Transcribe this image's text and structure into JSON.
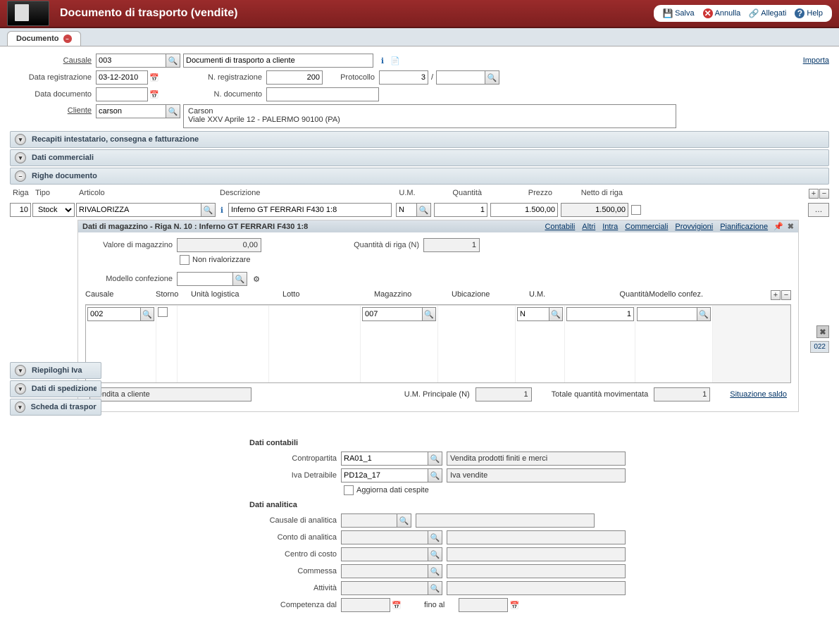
{
  "header": {
    "title": "Documento di trasporto (vendite)",
    "toolbar": {
      "save": "Salva",
      "cancel": "Annulla",
      "attach": "Allegati",
      "help": "Help"
    }
  },
  "tab": {
    "label": "Documento"
  },
  "form": {
    "causale_label": "Causale",
    "causale_value": "003",
    "causale_desc": "Documenti di trasporto a cliente",
    "data_reg_label": "Data registrazione",
    "data_reg_value": "03-12-2010",
    "nreg_label": "N. registrazione",
    "nreg_value": "200",
    "protocollo_label": "Protocollo",
    "protocollo_value": "3",
    "protocollo_sep": "/",
    "data_doc_label": "Data documento",
    "data_doc_value": "",
    "ndoc_label": "N. documento",
    "ndoc_value": "",
    "cliente_label": "Cliente",
    "cliente_value": "carson",
    "cliente_name": "Carson",
    "cliente_addr": "Viale XXV Aprile 12 - PALERMO 90100 (PA)",
    "importa": "Importa"
  },
  "sections": {
    "recapiti": "Recapiti intestatario, consegna e fatturazione",
    "commerciali": "Dati commerciali",
    "righe": "Righe documento",
    "riepiloghi": "Riepiloghi Iva",
    "spedizione": "Dati di spedizione",
    "scheda": "Scheda di trasporto"
  },
  "grid": {
    "headers": {
      "riga": "Riga",
      "tipo": "Tipo",
      "articolo": "Articolo",
      "descrizione": "Descrizione",
      "um": "U.M.",
      "quantita": "Quantità",
      "prezzo": "Prezzo",
      "netto": "Netto di riga"
    },
    "row": {
      "riga": "10",
      "tipo": "Stock",
      "articolo": "RIVALORIZZA",
      "descrizione": "Inferno GT FERRARI F430 1:8",
      "um": "N",
      "quantita": "1",
      "prezzo": "1.500,00",
      "netto": "1.500,00"
    },
    "more": "…"
  },
  "warehouse": {
    "title": "Dati di magazzino - Riga N. 10 : Inferno GT FERRARI F430 1:8",
    "tabs": {
      "contabili": "Contabili",
      "altri": "Altri",
      "intra": "Intra",
      "commerciali": "Commerciali",
      "provvigioni": "Provvigioni",
      "pianificazione": "Pianificazione"
    },
    "valore_label": "Valore di magazzino",
    "valore_value": "0,00",
    "qriga_label": "Quantità di riga (N)",
    "qriga_value": "1",
    "non_rival": "Non rivalorizzare",
    "modello_conf_label": "Modello confezione",
    "gridh": {
      "causale": "Causale",
      "storno": "Storno",
      "unita": "Unità logistica",
      "lotto": "Lotto",
      "magazzino": "Magazzino",
      "ubicazione": "Ubicazione",
      "um": "U.M.",
      "quantita": "Quantità",
      "modello": "Modello confez."
    },
    "gridrow": {
      "causale": "002",
      "magazzino": "007",
      "um": "N",
      "quantita": "1"
    },
    "footer": {
      "vendita": "Vendita a cliente",
      "um_princ_label": "U.M. Principale (N)",
      "um_princ_value": "1",
      "totale_label": "Totale quantità movimentata",
      "totale_value": "1",
      "situazione": "Situazione saldo"
    }
  },
  "side_tag": "022",
  "contabili": {
    "title": "Dati contabili",
    "contropartita_label": "Contropartita",
    "contropartita_value": "RA01_1",
    "contropartita_desc": "Vendita prodotti finiti e merci",
    "iva_label": "Iva Detraibile",
    "iva_value": "PD12a_17",
    "iva_desc": "Iva vendite",
    "aggiorna": "Aggiorna dati cespite"
  },
  "analitica": {
    "title": "Dati analitica",
    "causale": "Causale di analitica",
    "conto": "Conto di analitica",
    "centro": "Centro di costo",
    "commessa": "Commessa",
    "attivita": "Attività",
    "competenza_dal": "Competenza dal",
    "fino_al": "fino al"
  }
}
